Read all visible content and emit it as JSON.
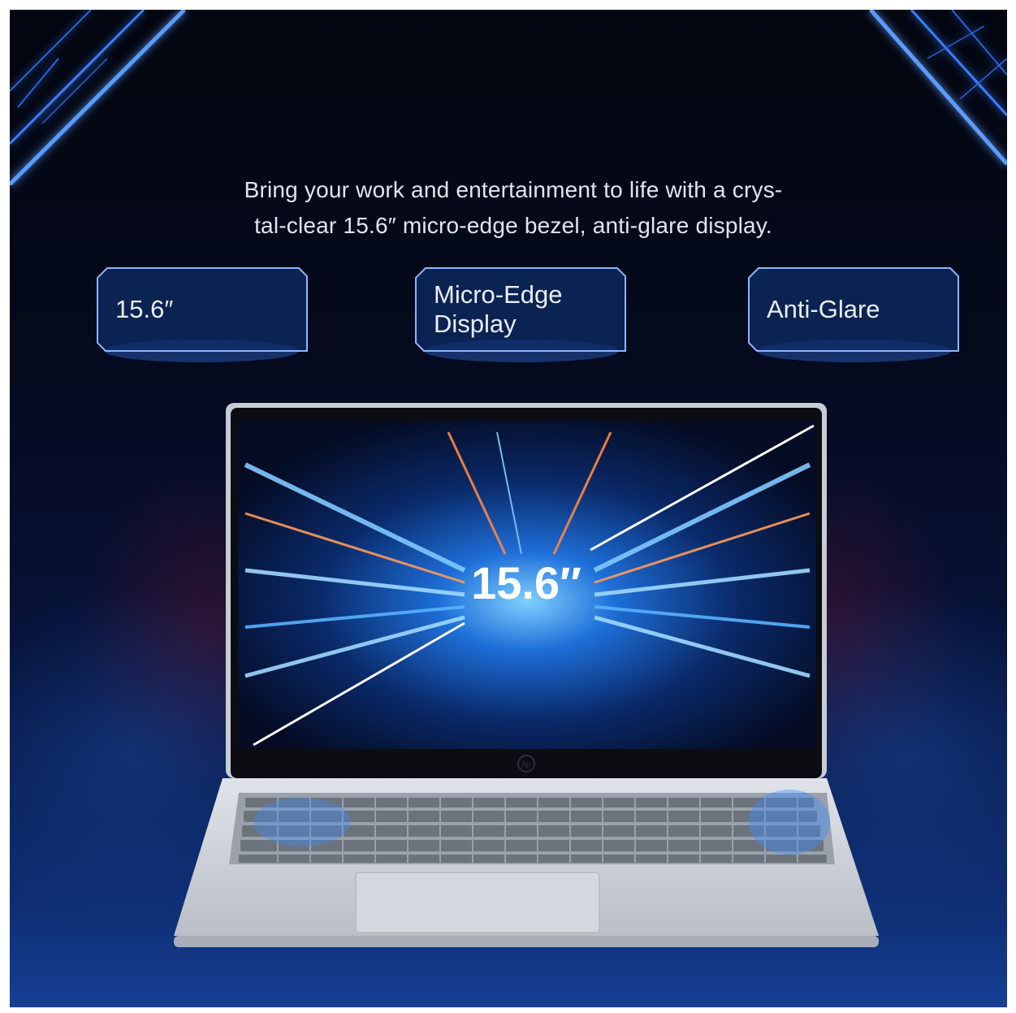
{
  "headline": {
    "line1": "Bring your work and entertainment to life with a crys-",
    "line2": "tal-clear 15.6″ micro-edge bezel, anti-glare display."
  },
  "badges": [
    {
      "label": "15.6″"
    },
    {
      "label": "Micro-Edge Display"
    },
    {
      "label": "Anti-Glare"
    }
  ],
  "screen": {
    "size_label": "15.6″"
  },
  "laptop": {
    "logo": "hp"
  },
  "colors": {
    "neon_blue": "#3a7bff",
    "badge_fill": "#0d2c64",
    "badge_border": "#8fb4ff",
    "chassis": "#c9ced6"
  }
}
